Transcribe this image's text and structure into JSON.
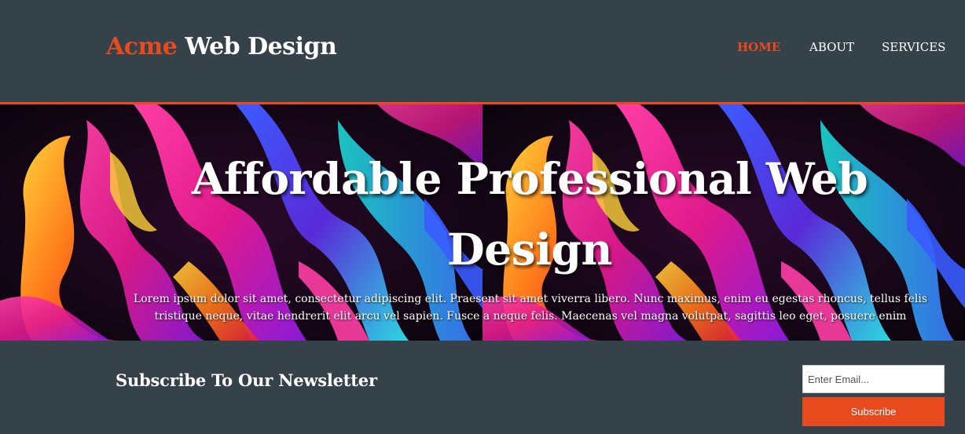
{
  "branding": {
    "highlight": "Acme",
    "rest": " Web Design"
  },
  "nav": {
    "items": [
      {
        "label": "HOME",
        "current": true
      },
      {
        "label": "ABOUT",
        "current": false
      },
      {
        "label": "SERVICES",
        "current": false
      }
    ]
  },
  "showcase": {
    "title": "Affordable Professional Web Design",
    "text": "Lorem ipsum dolor sit amet, consectetur adipiscing elit. Praesent sit amet viverra libero. Nunc maximus, enim eu egestas rhoncus, tellus felis tristique neque, vitae hendrerit elit arcu vel sapien. Fusce a neque felis. Maecenas vel magna volutpat, sagittis leo eget, posuere enim"
  },
  "newsletter": {
    "title": "Subscribe To Our Newsletter",
    "email_placeholder": "Enter Email...",
    "email_value": "",
    "subscribe_label": "Subscribe"
  },
  "colors": {
    "accent": "#e8491d",
    "background": "#35424a",
    "text": "#ffffff"
  }
}
